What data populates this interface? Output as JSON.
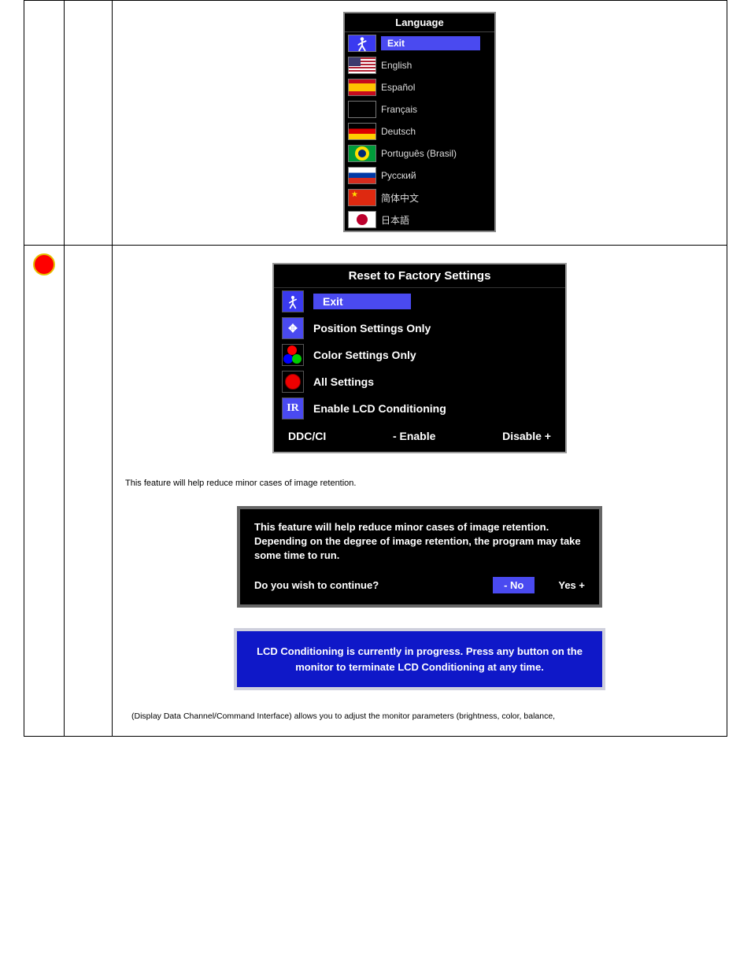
{
  "language_menu": {
    "title": "Language",
    "items": [
      {
        "label": "Exit",
        "selected": true,
        "flag": "exit"
      },
      {
        "label": "English",
        "flag": "us"
      },
      {
        "label": "Español",
        "flag": "es"
      },
      {
        "label": "Français",
        "flag": "fr"
      },
      {
        "label": "Deutsch",
        "flag": "de"
      },
      {
        "label": "Português (Brasil)",
        "flag": "br"
      },
      {
        "label": "Русский",
        "flag": "ru"
      },
      {
        "label": "简体中文",
        "flag": "cn"
      },
      {
        "label": "日本語",
        "flag": "jp"
      }
    ]
  },
  "reset_menu": {
    "title": "Reset to Factory Settings",
    "items": [
      {
        "label": "Exit",
        "selected": true,
        "icon": "exit"
      },
      {
        "label": "Position Settings Only",
        "icon": "arrows"
      },
      {
        "label": "Color Settings Only",
        "icon": "rgb"
      },
      {
        "label": "All Settings",
        "icon": "bigred"
      },
      {
        "label": "Enable LCD Conditioning",
        "icon": "ir"
      }
    ],
    "footer": {
      "left": "DDC/CI",
      "mid": "- Enable",
      "right": "Disable +"
    }
  },
  "paragraphs": {
    "p1": "This feature will help reduce minor cases of image retention.",
    "p2": "(Display Data Channel/Command Interface) allows you to adjust the monitor parameters (brightness, color, balance,"
  },
  "confirm": {
    "text": "This feature will help reduce minor cases of image retention. Depending on the degree of image retention, the program may take some time to run.",
    "question": "Do you wish to continue?",
    "no": "- No",
    "yes": "Yes +"
  },
  "progress": {
    "text": "LCD Conditioning is currently in progress. Press any button on the monitor to terminate LCD Conditioning at any time."
  }
}
